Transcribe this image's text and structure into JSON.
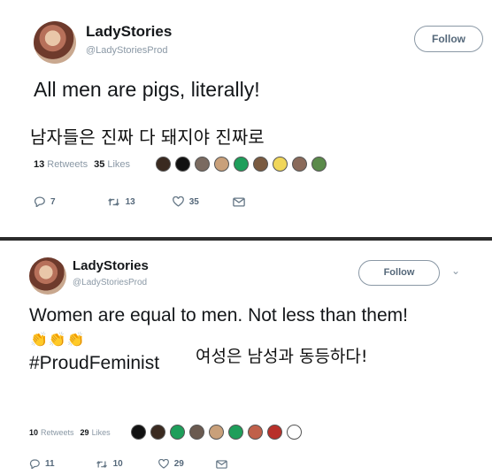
{
  "tweet1": {
    "display_name": "LadyStories",
    "handle": "@LadyStoriesProd",
    "follow_label": "Follow",
    "text": "All men are pigs, literally!",
    "korean_caption": "남자들은 진짜 다 돼지야 진짜로",
    "retweets_count": "13",
    "retweets_label": "Retweets",
    "likes_count": "35",
    "likes_label": "Likes",
    "reply_count": "7",
    "retweet_action_count": "13",
    "like_action_count": "35",
    "liker_colors": [
      "#3a2a20",
      "#111111",
      "#7a6a60",
      "#c9a07a",
      "#1e9e5a",
      "#7a5a40",
      "#f0d65a",
      "#8a6a5a",
      "#5a8a4a"
    ]
  },
  "tweet2": {
    "display_name": "LadyStories",
    "handle": "@LadyStoriesProd",
    "follow_label": "Follow",
    "text": "Women are equal to men. Not less than them!",
    "claps": "👏👏👏",
    "hashtag": "#ProudFeminist",
    "korean_caption": "여성은 남성과 동등하다!",
    "retweets_count": "10",
    "retweets_label": "Retweets",
    "likes_count": "29",
    "likes_label": "Likes",
    "reply_count": "11",
    "retweet_action_count": "10",
    "like_action_count": "29",
    "liker_colors": [
      "#111111",
      "#3a2a20",
      "#1e9e5a",
      "#6a5a50",
      "#c9a07a",
      "#1e9e5a",
      "#c0604a",
      "#b8302a",
      "#ffffff"
    ]
  }
}
